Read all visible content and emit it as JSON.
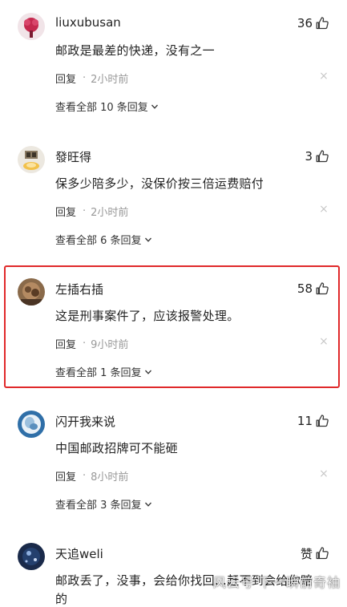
{
  "comments": [
    {
      "username": "liuxubusan",
      "likes": "36",
      "text": "邮政是最差的快递，没有之一",
      "reply": "回复",
      "time": "2小时前",
      "view_all": "查看全部 10 条回复"
    },
    {
      "username": "發旺得",
      "likes": "3",
      "text": "保多少陪多少，没保价按三倍运费赔付",
      "reply": "回复",
      "time": "2小时前",
      "view_all": "查看全部 6 条回复"
    },
    {
      "username": "左插右插",
      "likes": "58",
      "text": "这是刑事案件了，应该报警处理。",
      "reply": "回复",
      "time": "9小时前",
      "view_all": "查看全部 1 条回复"
    },
    {
      "username": "闪开我来说",
      "likes": "11",
      "text": "中国邮政招牌可不能砸",
      "reply": "回复",
      "time": "8小时前",
      "view_all": "查看全部 3 条回复"
    },
    {
      "username": "天追weli",
      "likes": "赞",
      "text": "邮政丢了，没事，会给你找回…赶不到会给你赔",
      "text_cont": "的",
      "reply": "",
      "time": "",
      "view_all": ""
    }
  ],
  "separator": "·",
  "close_glyph": "×",
  "watermark": "风云号 下一瞬前奇袖",
  "icons": {
    "like": "thumbs-up-icon",
    "close": "close-icon",
    "expand": "chevron-down-icon"
  },
  "colors": {
    "highlight_border": "#e0292a",
    "meta_gray": "#999999",
    "text": "#222222"
  }
}
